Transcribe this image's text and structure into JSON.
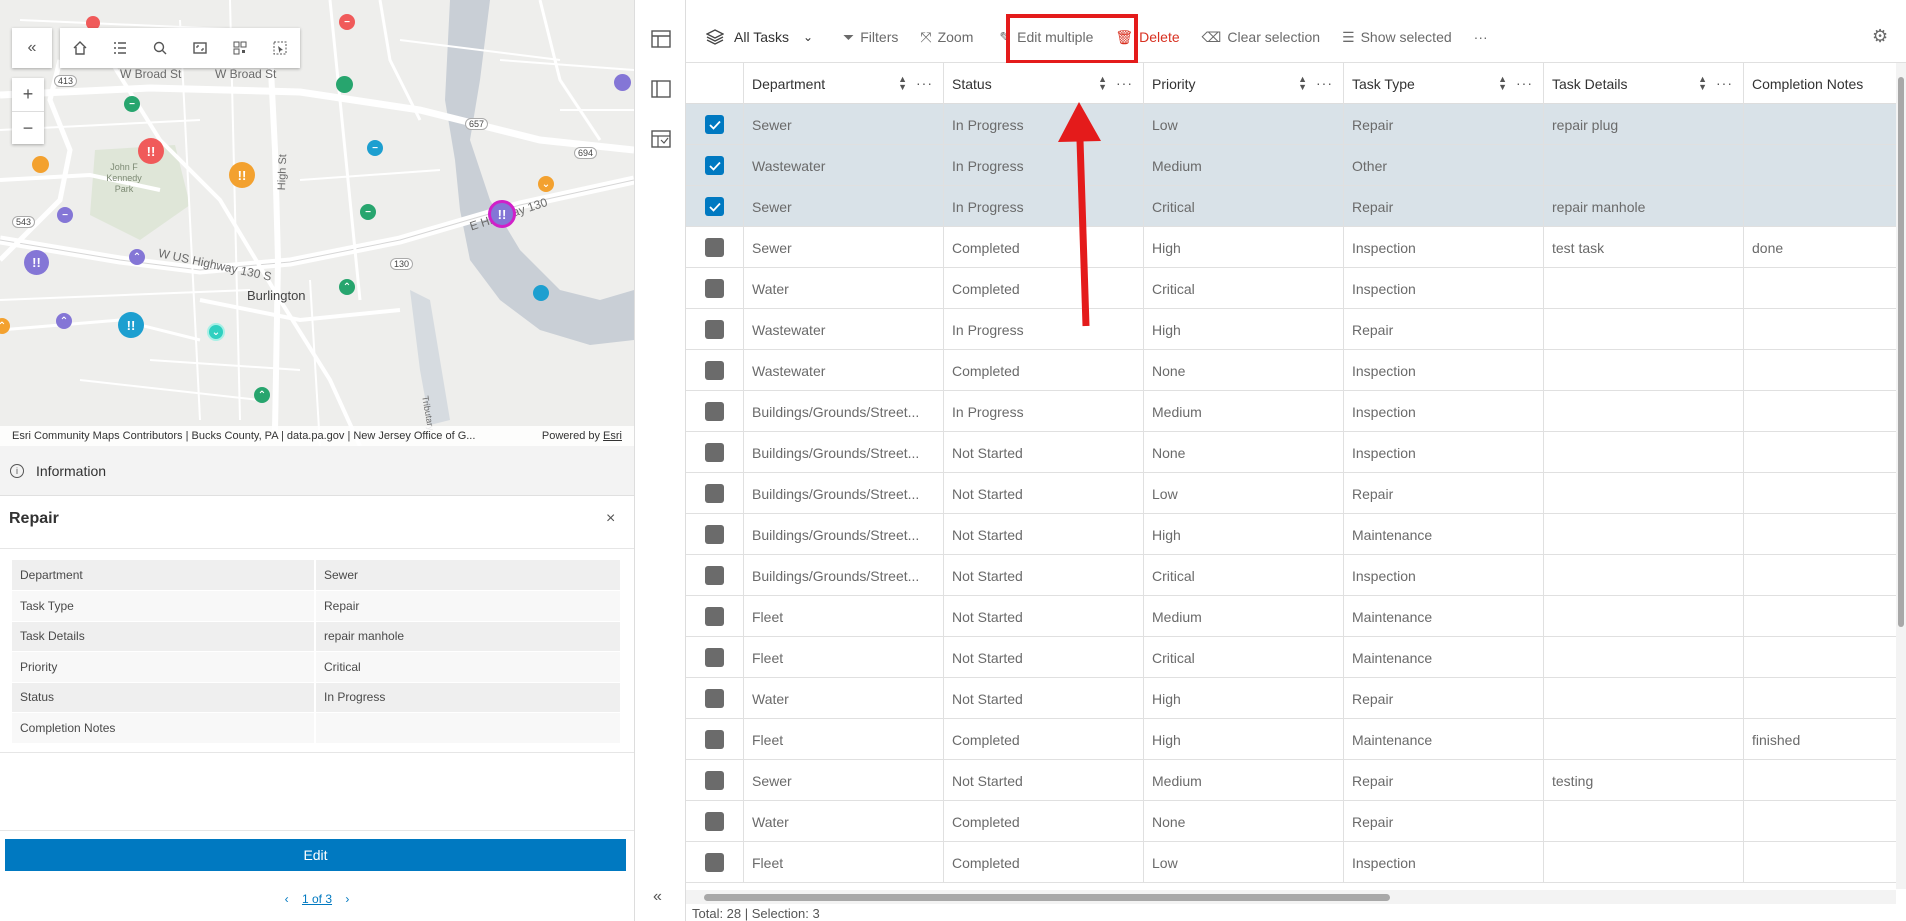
{
  "map": {
    "labels": {
      "broad1": "W Broad St",
      "broad2": "W Broad St",
      "high": "High St",
      "park": "John F Kennedy Park",
      "us130": "W US Highway 130 S",
      "highway": "E Highway 130",
      "burlington": "Burlington",
      "r413": "413",
      "r543": "543",
      "r657": "657",
      "r694": "694",
      "r130": "130",
      "tributary": "Tributary"
    },
    "attribution": "Esri Community Maps Contributors | Bucks County, PA | data.pa.gov | New Jersey Office of G...",
    "powered_by": "Powered by",
    "esri": "Esri",
    "zoom_in": "+",
    "zoom_out": "−",
    "collapse": "«"
  },
  "info": {
    "header": "Information",
    "popup_title": "Repair",
    "close": "×",
    "fields": [
      {
        "key": "Department",
        "value": "Sewer"
      },
      {
        "key": "Task Type",
        "value": "Repair"
      },
      {
        "key": "Task Details",
        "value": "repair manhole"
      },
      {
        "key": "Priority",
        "value": "Critical"
      },
      {
        "key": "Status",
        "value": "In Progress"
      },
      {
        "key": "Completion Notes",
        "value": ""
      }
    ],
    "edit_label": "Edit",
    "pager": "1 of 3",
    "prev": "‹",
    "next": "›"
  },
  "rail": {
    "collapse": "«"
  },
  "toolbar": {
    "layer": "All Tasks",
    "filters": "Filters",
    "zoom": "Zoom",
    "edit_multiple": "Edit multiple",
    "delete": "Delete",
    "clear_selection": "Clear selection",
    "show_selected": "Show selected",
    "more": "···"
  },
  "table": {
    "columns": [
      "Department",
      "Status",
      "Priority",
      "Task Type",
      "Task Details",
      "Completion Notes"
    ],
    "rows": [
      {
        "selected": true,
        "cells": [
          "Sewer",
          "In Progress",
          "Low",
          "Repair",
          "repair plug",
          ""
        ]
      },
      {
        "selected": true,
        "cells": [
          "Wastewater",
          "In Progress",
          "Medium",
          "Other",
          "",
          ""
        ]
      },
      {
        "selected": true,
        "cells": [
          "Sewer",
          "In Progress",
          "Critical",
          "Repair",
          "repair manhole",
          ""
        ]
      },
      {
        "selected": false,
        "cells": [
          "Sewer",
          "Completed",
          "High",
          "Inspection",
          "test task",
          "done"
        ]
      },
      {
        "selected": false,
        "cells": [
          "Water",
          "Completed",
          "Critical",
          "Inspection",
          "",
          ""
        ]
      },
      {
        "selected": false,
        "cells": [
          "Wastewater",
          "In Progress",
          "High",
          "Repair",
          "",
          ""
        ]
      },
      {
        "selected": false,
        "cells": [
          "Wastewater",
          "Completed",
          "None",
          "Inspection",
          "",
          ""
        ]
      },
      {
        "selected": false,
        "cells": [
          "Buildings/Grounds/Street...",
          "In Progress",
          "Medium",
          "Inspection",
          "",
          ""
        ]
      },
      {
        "selected": false,
        "cells": [
          "Buildings/Grounds/Street...",
          "Not Started",
          "None",
          "Inspection",
          "",
          ""
        ]
      },
      {
        "selected": false,
        "cells": [
          "Buildings/Grounds/Street...",
          "Not Started",
          "Low",
          "Repair",
          "",
          ""
        ]
      },
      {
        "selected": false,
        "cells": [
          "Buildings/Grounds/Street...",
          "Not Started",
          "High",
          "Maintenance",
          "",
          ""
        ]
      },
      {
        "selected": false,
        "cells": [
          "Buildings/Grounds/Street...",
          "Not Started",
          "Critical",
          "Inspection",
          "",
          ""
        ]
      },
      {
        "selected": false,
        "cells": [
          "Fleet",
          "Not Started",
          "Medium",
          "Maintenance",
          "",
          ""
        ]
      },
      {
        "selected": false,
        "cells": [
          "Fleet",
          "Not Started",
          "Critical",
          "Maintenance",
          "",
          ""
        ]
      },
      {
        "selected": false,
        "cells": [
          "Water",
          "Not Started",
          "High",
          "Repair",
          "",
          ""
        ]
      },
      {
        "selected": false,
        "cells": [
          "Fleet",
          "Completed",
          "High",
          "Maintenance",
          "",
          "finished"
        ]
      },
      {
        "selected": false,
        "cells": [
          "Sewer",
          "Not Started",
          "Medium",
          "Repair",
          "testing",
          ""
        ]
      },
      {
        "selected": false,
        "cells": [
          "Water",
          "Completed",
          "None",
          "Repair",
          "",
          ""
        ]
      },
      {
        "selected": false,
        "cells": [
          "Fleet",
          "Completed",
          "Low",
          "Inspection",
          "",
          ""
        ]
      }
    ],
    "footer": "Total: 28 | Selection: 3"
  },
  "colors": {
    "accent": "#0079c1",
    "delete": "#d83020",
    "highlight": "#e41b1b",
    "selected_row": "#d9e2e8"
  }
}
